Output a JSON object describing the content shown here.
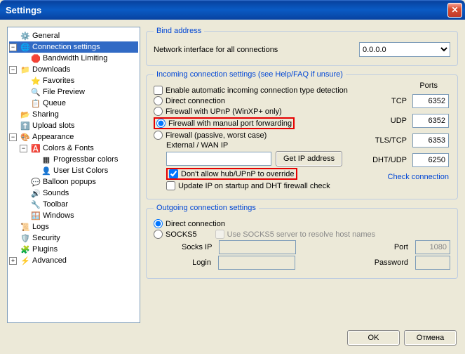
{
  "window": {
    "title": "Settings"
  },
  "tree": {
    "items": [
      {
        "label": "General",
        "icon": "⚙️",
        "indent": 0,
        "toggle": ""
      },
      {
        "label": "Connection settings",
        "icon": "🌐",
        "indent": 0,
        "toggle": "−",
        "selected": true
      },
      {
        "label": "Bandwidth Limiting",
        "icon": "🛑",
        "indent": 1,
        "toggle": ""
      },
      {
        "label": "Downloads",
        "icon": "📁",
        "indent": 0,
        "toggle": "−"
      },
      {
        "label": "Favorites",
        "icon": "⭐",
        "indent": 1,
        "toggle": ""
      },
      {
        "label": "File Preview",
        "icon": "🔍",
        "indent": 1,
        "toggle": ""
      },
      {
        "label": "Queue",
        "icon": "📋",
        "indent": 1,
        "toggle": ""
      },
      {
        "label": "Sharing",
        "icon": "📂",
        "indent": 0,
        "toggle": ""
      },
      {
        "label": "Upload slots",
        "icon": "⬆️",
        "indent": 0,
        "toggle": ""
      },
      {
        "label": "Appearance",
        "icon": "🎨",
        "indent": 0,
        "toggle": "−"
      },
      {
        "label": "Colors & Fonts",
        "icon": "🅰️",
        "indent": 1,
        "toggle": "−"
      },
      {
        "label": "Progressbar colors",
        "icon": "▦",
        "indent": 2,
        "toggle": ""
      },
      {
        "label": "User List Colors",
        "icon": "👤",
        "indent": 2,
        "toggle": ""
      },
      {
        "label": "Balloon popups",
        "icon": "💬",
        "indent": 1,
        "toggle": ""
      },
      {
        "label": "Sounds",
        "icon": "🔊",
        "indent": 1,
        "toggle": ""
      },
      {
        "label": "Toolbar",
        "icon": "🔧",
        "indent": 1,
        "toggle": ""
      },
      {
        "label": "Windows",
        "icon": "🪟",
        "indent": 1,
        "toggle": ""
      },
      {
        "label": "Logs",
        "icon": "📜",
        "indent": 0,
        "toggle": ""
      },
      {
        "label": "Security",
        "icon": "🛡️",
        "indent": 0,
        "toggle": ""
      },
      {
        "label": "Plugins",
        "icon": "🧩",
        "indent": 0,
        "toggle": ""
      },
      {
        "label": "Advanced",
        "icon": "⚡",
        "indent": 0,
        "toggle": "+"
      }
    ]
  },
  "bind": {
    "legend": "Bind address",
    "label": "Network interface for all connections",
    "value": "0.0.0.0"
  },
  "incoming": {
    "legend": "Incoming connection settings (see Help/FAQ if unsure)",
    "auto_detect": "Enable automatic incoming connection type detection",
    "opt_direct": "Direct connection",
    "opt_upnp": "Firewall with UPnP (WinXP+ only)",
    "opt_manual": "Firewall with manual port forwarding",
    "opt_passive": "Firewall (passive, worst case)",
    "extip_label": "External / WAN IP",
    "extip_value": "",
    "get_ip": "Get IP address",
    "no_override": "Don't allow hub/UPnP to override",
    "update_ip": "Update IP on startup and DHT firewall check",
    "ports_header": "Ports",
    "tcp_label": "TCP",
    "tcp": "6352",
    "udp_label": "UDP",
    "udp": "6352",
    "tls_label": "TLS/TCP",
    "tls": "6353",
    "dht_label": "DHT/UDP",
    "dht": "6250",
    "check": "Check connection"
  },
  "outgoing": {
    "legend": "Outgoing connection settings",
    "opt_direct": "Direct connection",
    "opt_socks": "SOCKS5",
    "use_socks_dns": "Use SOCKS5 server to resolve host names",
    "socks_ip_label": "Socks IP",
    "socks_ip": "",
    "port_label": "Port",
    "port": "1080",
    "login_label": "Login",
    "login": "",
    "password_label": "Password",
    "password": ""
  },
  "buttons": {
    "ok": "OK",
    "cancel": "Отмена"
  }
}
